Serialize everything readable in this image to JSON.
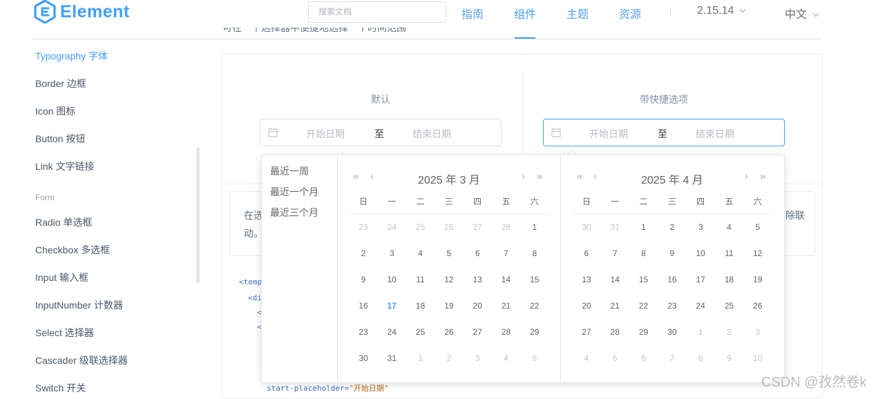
{
  "header": {
    "logo_text": "Element",
    "search_placeholder": "搜索文档",
    "nav": [
      {
        "label": "指南"
      },
      {
        "label": "组件"
      },
      {
        "label": "主题"
      },
      {
        "label": "资源"
      }
    ],
    "version": "2.15.14",
    "language": "中文"
  },
  "sidebar": {
    "items": [
      {
        "label": "Typography 字体"
      },
      {
        "label": "Border 边框"
      },
      {
        "label": "Icon 图标"
      },
      {
        "label": "Button 按钮"
      },
      {
        "label": "Link 文字链接"
      }
    ],
    "group_form": "Form",
    "form_items": [
      {
        "label": "Radio 单选框"
      },
      {
        "label": "Checkbox 多选框"
      },
      {
        "label": "Input 输入框"
      },
      {
        "label": "InputNumber 计数器"
      },
      {
        "label": "Select 选择器"
      },
      {
        "label": "Cascader 级联选择器"
      },
      {
        "label": "Switch 开关"
      }
    ]
  },
  "demo": {
    "top_text": "可在一个选择器中便捷地选择一个时间范围",
    "left_label": "默认",
    "right_label": "带快捷选项",
    "start_placeholder": "开始日期",
    "end_placeholder": "结束日期",
    "range_separator": "至",
    "desc_line1_start": "在选",
    "desc_line1_end": "除联",
    "desc_line2": "动。",
    "code": [
      "<temp",
      "<di",
      "<",
      "<"
    ],
    "code_last_attr": "start-placeholder=",
    "code_last_value": "\"开始日期\""
  },
  "picker": {
    "shortcuts": [
      "最近一周",
      "最近一个月",
      "最近三个月"
    ],
    "left_title": "2025 年 3 月",
    "right_title": "2025 年 4 月",
    "weekdays": [
      "日",
      "一",
      "二",
      "三",
      "四",
      "五",
      "六"
    ],
    "left_days": [
      [
        "23",
        "24",
        "25",
        "26",
        "27",
        "28",
        "1"
      ],
      [
        "2",
        "3",
        "4",
        "5",
        "6",
        "7",
        "8"
      ],
      [
        "9",
        "10",
        "11",
        "12",
        "13",
        "14",
        "15"
      ],
      [
        "16",
        "17",
        "18",
        "19",
        "20",
        "21",
        "22"
      ],
      [
        "23",
        "24",
        "25",
        "26",
        "27",
        "28",
        "29"
      ],
      [
        "30",
        "31",
        "1",
        "2",
        "3",
        "4",
        "5"
      ]
    ],
    "left_other": [
      [
        0,
        0
      ],
      [
        0,
        1
      ],
      [
        0,
        2
      ],
      [
        0,
        3
      ],
      [
        0,
        4
      ],
      [
        0,
        5
      ],
      [
        5,
        2
      ],
      [
        5,
        3
      ],
      [
        5,
        4
      ],
      [
        5,
        5
      ],
      [
        5,
        6
      ]
    ],
    "left_today": [
      3,
      1
    ],
    "right_days": [
      [
        "30",
        "31",
        "1",
        "2",
        "3",
        "4",
        "5"
      ],
      [
        "6",
        "7",
        "8",
        "9",
        "10",
        "11",
        "12"
      ],
      [
        "13",
        "14",
        "15",
        "16",
        "17",
        "18",
        "19"
      ],
      [
        "20",
        "21",
        "22",
        "23",
        "24",
        "25",
        "26"
      ],
      [
        "27",
        "28",
        "29",
        "30",
        "1",
        "2",
        "3"
      ],
      [
        "4",
        "5",
        "6",
        "7",
        "8",
        "9",
        "10"
      ]
    ],
    "right_other": [
      [
        0,
        0
      ],
      [
        0,
        1
      ],
      [
        4,
        4
      ],
      [
        4,
        5
      ],
      [
        4,
        6
      ],
      [
        5,
        0
      ],
      [
        5,
        1
      ],
      [
        5,
        2
      ],
      [
        5,
        3
      ],
      [
        5,
        4
      ],
      [
        5,
        5
      ],
      [
        5,
        6
      ]
    ]
  },
  "watermark": "CSDN @孜然卷k",
  "colors": {
    "primary": "#409eff",
    "text_regular": "#606266",
    "placeholder": "#c0c4cc"
  }
}
